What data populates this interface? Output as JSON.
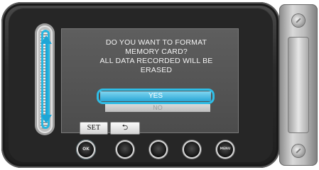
{
  "dialog": {
    "lines": [
      "DO YOU WANT TO FORMAT",
      "MEMORY CARD?",
      "ALL DATA RECORDED WILL BE",
      "ERASED"
    ],
    "options": {
      "yes": "YES",
      "no": "NO"
    }
  },
  "softkeys": {
    "set": "SET",
    "back": "⮌"
  },
  "buttons": {
    "ok": "OK",
    "menu": "MENU"
  },
  "icons": {
    "slider": "up-down-arrow-icon",
    "back": "return-arrow-icon"
  },
  "colors": {
    "highlight": "#2fbde6",
    "screen": "#555555"
  }
}
